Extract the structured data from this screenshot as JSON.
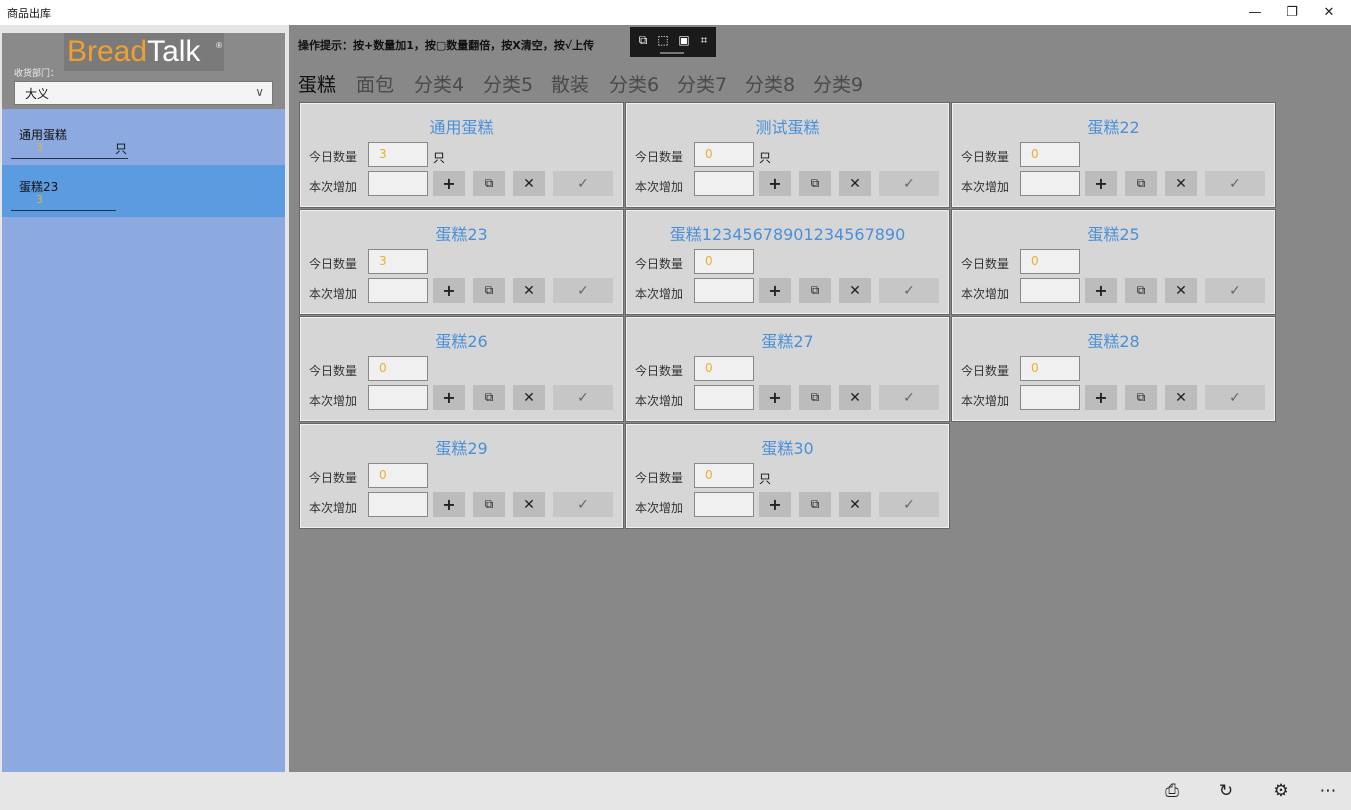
{
  "window": {
    "title": "商品出库",
    "min_glyph": "—",
    "max_glyph": "❐",
    "close_glyph": "✕"
  },
  "sidebar": {
    "logo_part1": "Bread",
    "logo_part2": "Talk",
    "logo_reg": "®",
    "dept_label": "收货部门：",
    "dept_value": "大义",
    "items": [
      {
        "name": "通用蛋糕",
        "qty": "3",
        "unit": "只"
      },
      {
        "name": "蛋糕23",
        "qty": "3",
        "unit": ""
      }
    ]
  },
  "main": {
    "hint": "操作提示：按+数量加1，按▢数量翻倍，按X清空，按√上传",
    "tabs": [
      "蛋糕",
      "面包",
      "分类4",
      "分类5",
      "散装",
      "分类6",
      "分类7",
      "分类8",
      "分类9"
    ],
    "labels": {
      "today": "今日数量",
      "add": "本次增加"
    },
    "buttons": {
      "plus": "+",
      "copy": "⧉",
      "clear": "✕",
      "ok": "✓"
    },
    "cards": [
      {
        "title": "通用蛋糕",
        "today": "3",
        "unit": "只"
      },
      {
        "title": "测试蛋糕",
        "today": "0",
        "unit": "只"
      },
      {
        "title": "蛋糕22",
        "today": "0",
        "unit": ""
      },
      {
        "title": "蛋糕23",
        "today": "3",
        "unit": ""
      },
      {
        "title": "蛋糕12345678901234567890",
        "today": "0",
        "unit": ""
      },
      {
        "title": "蛋糕25",
        "today": "0",
        "unit": ""
      },
      {
        "title": "蛋糕26",
        "today": "0",
        "unit": ""
      },
      {
        "title": "蛋糕27",
        "today": "0",
        "unit": ""
      },
      {
        "title": "蛋糕28",
        "today": "0",
        "unit": ""
      },
      {
        "title": "蛋糕29",
        "today": "0",
        "unit": ""
      },
      {
        "title": "蛋糕30",
        "today": "0",
        "unit": "只"
      }
    ]
  },
  "toolbox_icons": [
    "new-window-icon",
    "select-icon",
    "frame-icon",
    "adjust-icon"
  ],
  "bottom_icons": [
    "print-icon",
    "refresh-icon",
    "settings-icon",
    "more-icon"
  ]
}
